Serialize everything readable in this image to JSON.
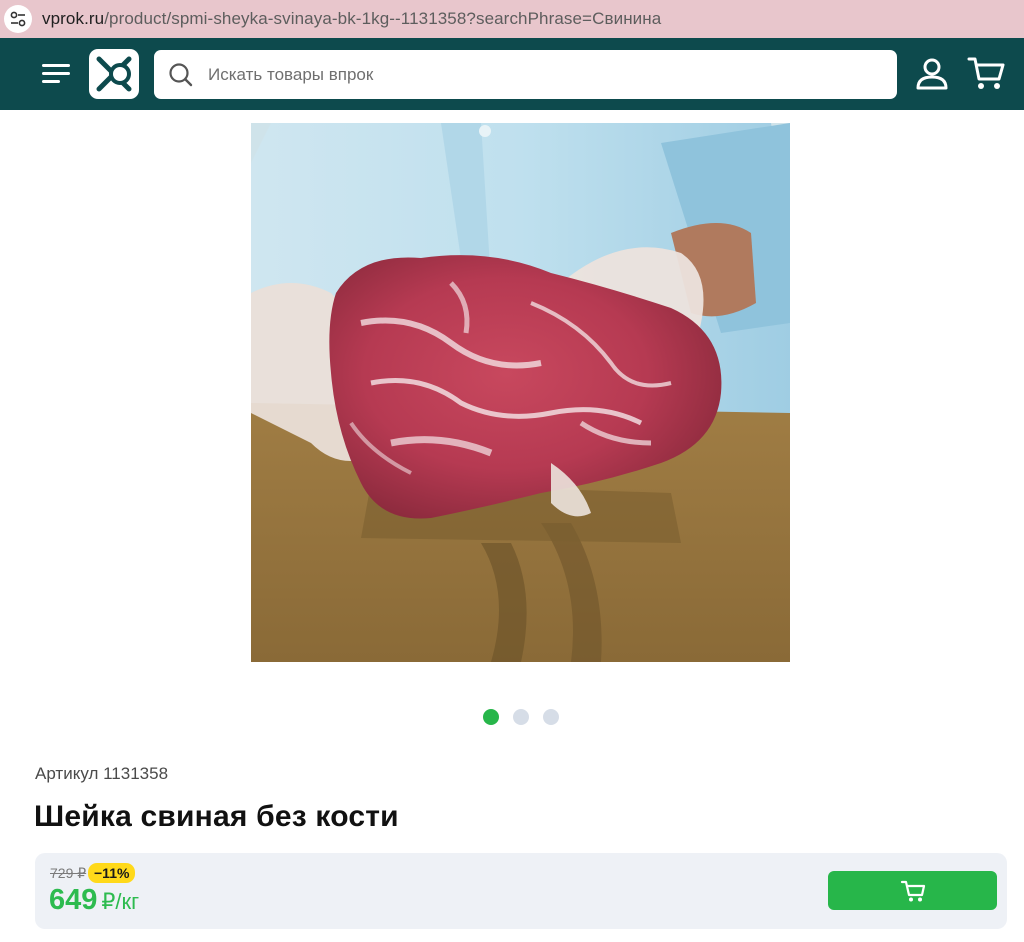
{
  "browser": {
    "url_domain": "vprok.ru",
    "url_path": "/product/spmi-sheyka-svinaya-bk-1kg--1131358?searchPhrase=Свинина"
  },
  "header": {
    "background": "#0d4a4d",
    "search_placeholder": "Искать товары впрок",
    "icons": [
      "menu-icon",
      "logo",
      "search-icon",
      "user-icon",
      "cart-icon"
    ]
  },
  "gallery": {
    "slides_total": 3,
    "active_slide": 1
  },
  "product": {
    "article": "Артикул 1131358",
    "title": "Шейка свиная без кости",
    "old_price": "729 ₽",
    "discount": "−11%",
    "price": "649",
    "price_unit": "₽/кг"
  },
  "colors": {
    "accent_green": "#27b64a",
    "price_green": "#2dbb4f",
    "discount_yellow": "#ffd91a"
  }
}
